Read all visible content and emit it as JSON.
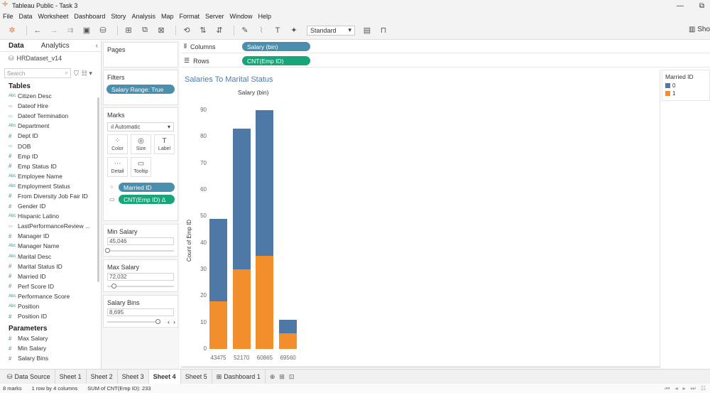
{
  "window": {
    "title": "Tableau Public - Task 3",
    "min": "—",
    "max": "⧉"
  },
  "menu": [
    "File",
    "Data",
    "Worksheet",
    "Dashboard",
    "Story",
    "Analysis",
    "Map",
    "Format",
    "Server",
    "Window",
    "Help"
  ],
  "toolbar": {
    "fit_select": "Standard",
    "show_me": "Sho"
  },
  "data_pane": {
    "tabs": {
      "data": "Data",
      "analytics": "Analytics"
    },
    "source": "HRDataset_v14",
    "search_placeholder": "Search",
    "tables_heading": "Tables",
    "fields": [
      {
        "icon": "Abc",
        "name": "Citizen Desc"
      },
      {
        "icon": "▭",
        "name": "Dateof Hire"
      },
      {
        "icon": "▭",
        "name": "Dateof Termination"
      },
      {
        "icon": "Abc",
        "name": "Department"
      },
      {
        "icon": "#",
        "name": "Dept ID"
      },
      {
        "icon": "▭",
        "name": "DOB"
      },
      {
        "icon": "#",
        "name": "Emp ID"
      },
      {
        "icon": "#",
        "name": "Emp Status ID"
      },
      {
        "icon": "Abc",
        "name": "Employee Name"
      },
      {
        "icon": "Abc",
        "name": "Employment Status"
      },
      {
        "icon": "#",
        "name": "From Diversity Job Fair ID"
      },
      {
        "icon": "#",
        "name": "Gender ID"
      },
      {
        "icon": "Abc",
        "name": "Hispanic Latino"
      },
      {
        "icon": "▭",
        "name": "LastPerformanceReview ..."
      },
      {
        "icon": "#",
        "name": "Manager ID"
      },
      {
        "icon": "Abc",
        "name": "Manager Name"
      },
      {
        "icon": "Abc",
        "name": "Marital Desc"
      },
      {
        "icon": "#",
        "name": "Marital Status ID"
      },
      {
        "icon": "#",
        "name": "Married ID"
      },
      {
        "icon": "#",
        "name": "Perf Score ID"
      },
      {
        "icon": "Abc",
        "name": "Performance Score"
      },
      {
        "icon": "Abc",
        "name": "Position"
      },
      {
        "icon": "#",
        "name": "Position ID"
      }
    ],
    "parameters_heading": "Parameters",
    "parameters": [
      {
        "icon": "#",
        "name": "Max Salary"
      },
      {
        "icon": "#",
        "name": "Min Salary"
      },
      {
        "icon": "#",
        "name": "Salary Bins"
      }
    ]
  },
  "cards": {
    "pages": "Pages",
    "filters": "Filters",
    "filter_pill": "Salary Range: True",
    "marks": "Marks",
    "marks_type": "Automatic",
    "mark_buttons": [
      {
        "glyph": "⁘",
        "label": "Color"
      },
      {
        "glyph": "◎",
        "label": "Size"
      },
      {
        "glyph": "T",
        "label": "Label"
      },
      {
        "glyph": "⋯",
        "label": "Detail"
      },
      {
        "glyph": "▭",
        "label": "Tooltip"
      }
    ],
    "color_pill": "Married ID",
    "tooltip_pill": "CNT(Emp ID)  ∆",
    "min_salary": {
      "title": "Min Salary",
      "value": "45,046",
      "level": 0.0
    },
    "max_salary": {
      "title": "Max Salary",
      "value": "72,032",
      "level": 0.1
    },
    "salary_bins": {
      "title": "Salary Bins",
      "value": "8,695",
      "level": 0.95
    }
  },
  "shelves": {
    "columns_label": "Columns",
    "columns_pill": "Salary (bin)",
    "rows_label": "Rows",
    "rows_pill": "CNT(Emp ID)"
  },
  "colors": {
    "series0": "#4e79a7",
    "series1": "#f28e2b",
    "title": "#4a7cb0"
  },
  "chart_data": {
    "type": "bar",
    "stacked": true,
    "title": "Salaries To Marital Status",
    "column_header": "Salary (bin)",
    "ylabel": "Count of Emp ID",
    "categories": [
      "43475",
      "52170",
      "60865",
      "69560"
    ],
    "series": [
      {
        "name": "0",
        "values": [
          31,
          53,
          55,
          5
        ]
      },
      {
        "name": "1",
        "values": [
          18,
          30,
          35,
          6
        ]
      }
    ],
    "ylim": [
      0,
      95
    ],
    "yticks": [
      0,
      10,
      20,
      30,
      40,
      50,
      60,
      70,
      80,
      90
    ],
    "legend": {
      "title": "Married ID",
      "position": "right"
    }
  },
  "sheet_tabs": {
    "data_source": "Data Source",
    "sheets": [
      "Sheet 1",
      "Sheet 2",
      "Sheet 3",
      "Sheet 4",
      "Sheet 5",
      "Dashboard 1"
    ],
    "active": "Sheet 4"
  },
  "status": {
    "marks": "8 marks",
    "dims": "1 row by 4 columns",
    "sum": "SUM of CNT(Emp ID): 233"
  }
}
